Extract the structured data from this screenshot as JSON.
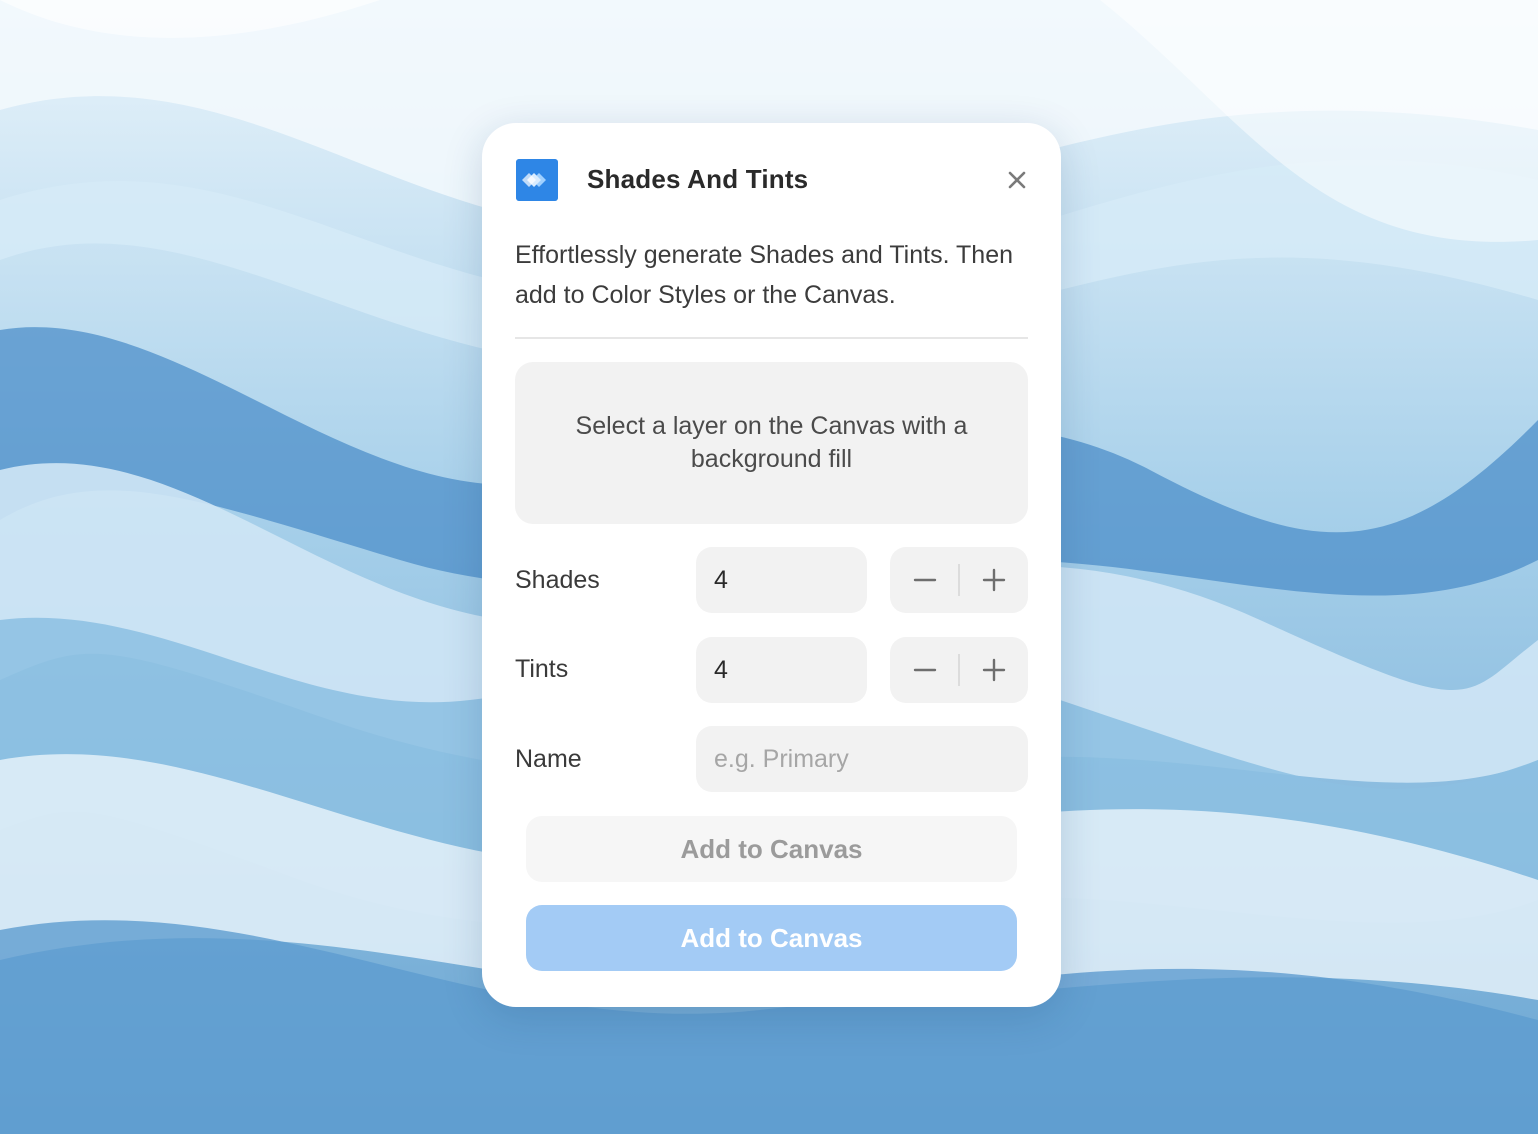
{
  "dialog": {
    "title": "Shades And Tints",
    "app_icon": "shades-tints-logo-icon",
    "close_icon": "close-icon",
    "description": "Effortlessly generate Shades and Tints. Then add to Color Styles or the Canvas.",
    "notice": "Select a layer on the Canvas with a background fill"
  },
  "form": {
    "shades": {
      "label": "Shades",
      "value": "4"
    },
    "tints": {
      "label": "Tints",
      "value": "4"
    },
    "name": {
      "label": "Name",
      "placeholder": "e.g. Primary",
      "value": ""
    }
  },
  "actions": {
    "secondary_label": "Add to Canvas",
    "primary_label": "Add to Canvas"
  },
  "colors": {
    "accent": "#2e86e6",
    "primary_button_disabled": "#a3cbf5",
    "field_background": "#f2f2f2"
  }
}
